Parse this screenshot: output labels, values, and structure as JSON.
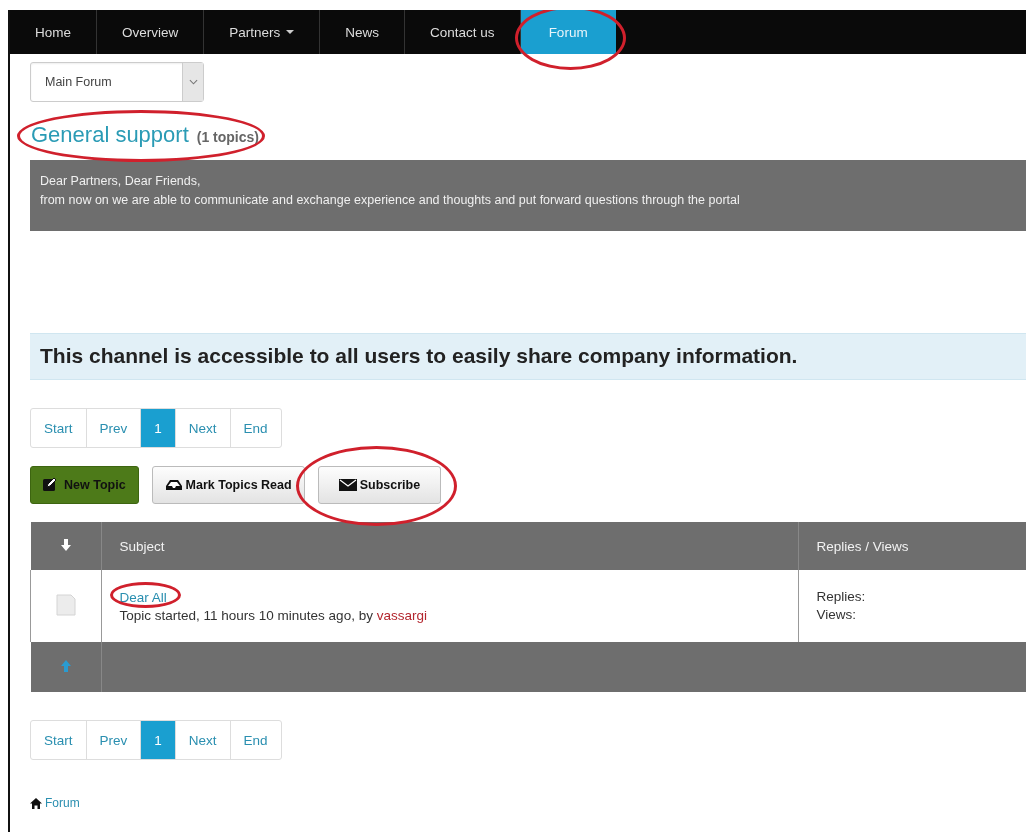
{
  "nav": {
    "items": [
      {
        "label": "Home",
        "selected": false,
        "dropdown": false,
        "circled": false
      },
      {
        "label": "Overview",
        "selected": false,
        "dropdown": false,
        "circled": false
      },
      {
        "label": "Partners",
        "selected": false,
        "dropdown": true,
        "circled": false
      },
      {
        "label": "News",
        "selected": false,
        "dropdown": false,
        "circled": false
      },
      {
        "label": "Contact us",
        "selected": false,
        "dropdown": false,
        "circled": false
      },
      {
        "label": "Forum",
        "selected": true,
        "dropdown": false,
        "circled": true
      }
    ]
  },
  "forum_select": {
    "value": "Main Forum"
  },
  "heading": {
    "title": "General support",
    "count": "(1 topics)",
    "circled": true
  },
  "message": {
    "lines": [
      "Dear Partners, Dear Friends,",
      "from now on we are able to communicate and exchange experience and thoughts and put forward questions through the portal"
    ]
  },
  "banner": {
    "text": "This channel is accessible to all users to easily share company information."
  },
  "pagination_top": [
    {
      "label": "Start",
      "selected": false
    },
    {
      "label": "Prev",
      "selected": false
    },
    {
      "label": "1",
      "selected": true
    },
    {
      "label": "Next",
      "selected": false
    },
    {
      "label": "End",
      "selected": false
    }
  ],
  "actions": [
    {
      "label": "New Topic",
      "kind": "new",
      "circled": false
    },
    {
      "label": "Mark Topics Read",
      "kind": "mark",
      "circled": false
    },
    {
      "label": "Subscribe",
      "kind": "subscribe",
      "circled": true
    }
  ],
  "table": {
    "columns": [
      {
        "kind": "sort"
      },
      {
        "kind": "text",
        "label": "Subject"
      },
      {
        "kind": "text",
        "label": "Replies / Views"
      }
    ],
    "rows": [
      {
        "subject": "Dear All",
        "circled": true,
        "meta": "Topic started, 11 hours 10 minutes ago, by",
        "author": "vassargi",
        "stats": [
          "Replies:",
          "Views:"
        ]
      }
    ]
  },
  "pagination_bottom": [
    {
      "label": "Start",
      "selected": false
    },
    {
      "label": "Prev",
      "selected": false
    },
    {
      "label": "1",
      "selected": true
    },
    {
      "label": "Next",
      "selected": false
    },
    {
      "label": "End",
      "selected": false
    }
  ],
  "breadcrumb": {
    "label": "Forum"
  }
}
